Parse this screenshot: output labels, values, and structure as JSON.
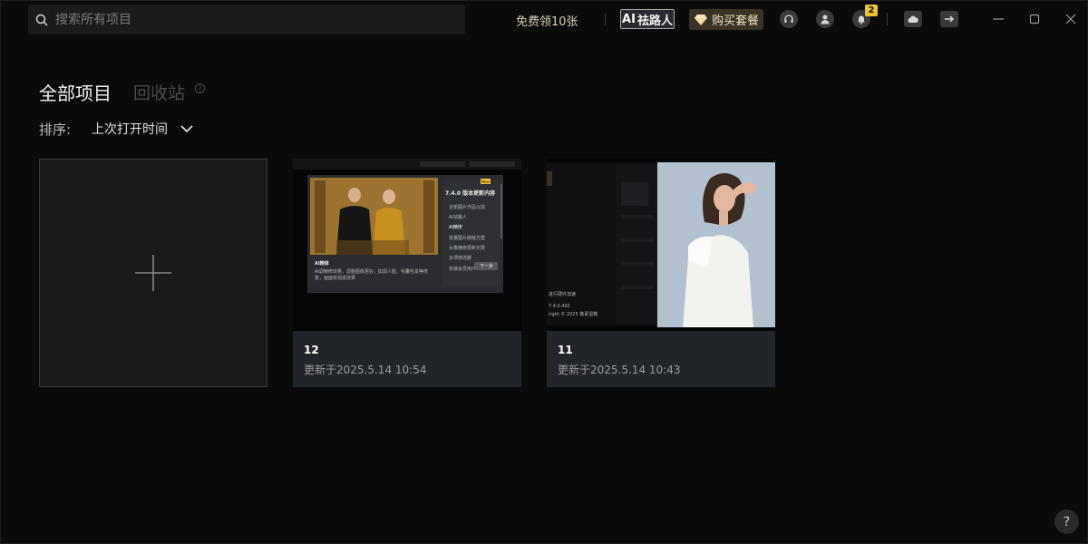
{
  "search": {
    "placeholder": "搜索所有项目"
  },
  "header": {
    "free_link": "免费领10张",
    "ai_button": {
      "mark": "AI",
      "label": "祛路人"
    },
    "buy_button": "购买套餐",
    "notification_count": "2"
  },
  "tabs": {
    "all": "全部项目",
    "trash": "回收站",
    "trash_help": "?"
  },
  "sort": {
    "label": "排序:",
    "value": "上次打开时间"
  },
  "projects": [
    {
      "name": "12",
      "updated": "更新于2025.5.14 10:54",
      "preview": {
        "title": "7.4.0 版本更新内容",
        "tag": "New",
        "menu": [
          "全新图片作品以前",
          "AI祛路人",
          "AI精修",
          "批量图片跑版方案",
          "头像精修更新无限",
          "多项修改脚",
          "安装会员用户"
        ],
        "caption_title": "AI精修",
        "caption_text": "AI调精修效果，调整图像更好，如调人脸、毛囊毛发等修复，画面有强说效果",
        "next_button": "下一步"
      }
    },
    {
      "name": "11",
      "updated": "更新于2025.5.14 10:43",
      "preview": {
        "lines": [
          "进行硬件加速",
          "7.4.0.492",
          "right © 2025 像素蛋糕"
        ]
      }
    }
  ],
  "help_button": "?",
  "colors": {
    "accent_gold": "#f4c430",
    "card_info_bg": "#22252a",
    "background": "#0b0b0c"
  }
}
